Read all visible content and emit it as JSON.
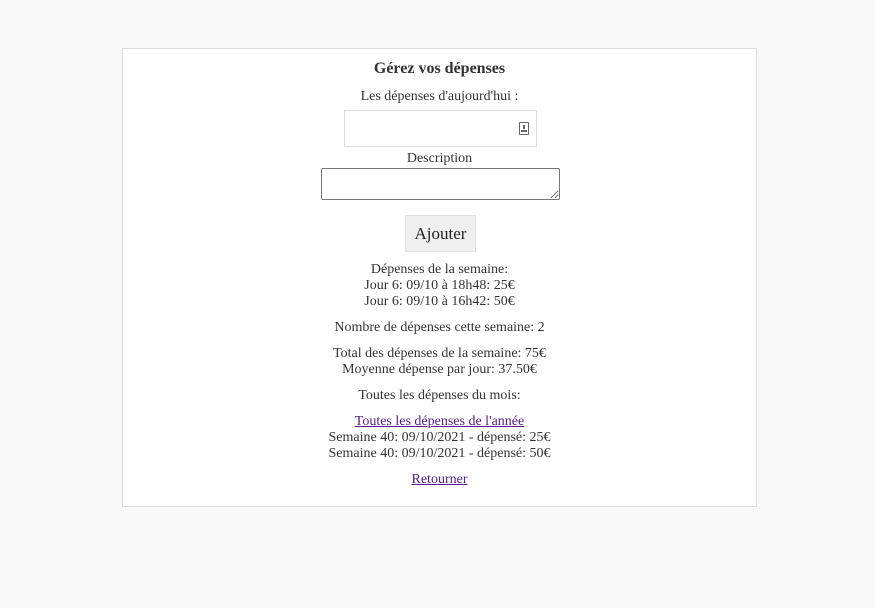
{
  "form": {
    "title": "Gérez vos dépenses",
    "amount_label": "Les dépenses d'aujourd'hui :",
    "amount_value": "",
    "description_label": "Description",
    "description_value": "",
    "add_button_label": "Ajouter"
  },
  "summary": {
    "week_heading": "Dépenses de la semaine:",
    "week_entries": [
      "Jour 6: 09/10 à 18h48: 25€",
      "Jour 6: 09/10 à 16h42: 50€"
    ],
    "count_text": "Nombre de dépenses cette semaine: 2",
    "total_text": "Total des dépenses de la semaine: 75€",
    "average_text": "Moyenne dépense par jour: 37.50€",
    "month_heading": "Toutes les dépenses du mois:",
    "year_link_label": "Toutes les dépenses de l'année",
    "year_entries": [
      "Semaine 40: 09/10/2021 - dépensé: 25€",
      "Semaine 40: 09/10/2021 - dépensé: 50€"
    ],
    "back_link_label": "Retourner"
  },
  "colors": {
    "page_background": "#f8f8f8",
    "card_background": "#ffffff",
    "text": "#333333",
    "link_visited": "#551a8b",
    "button_background": "#efefef"
  },
  "icons": {
    "amount_field_icon": "contact-card-icon"
  }
}
